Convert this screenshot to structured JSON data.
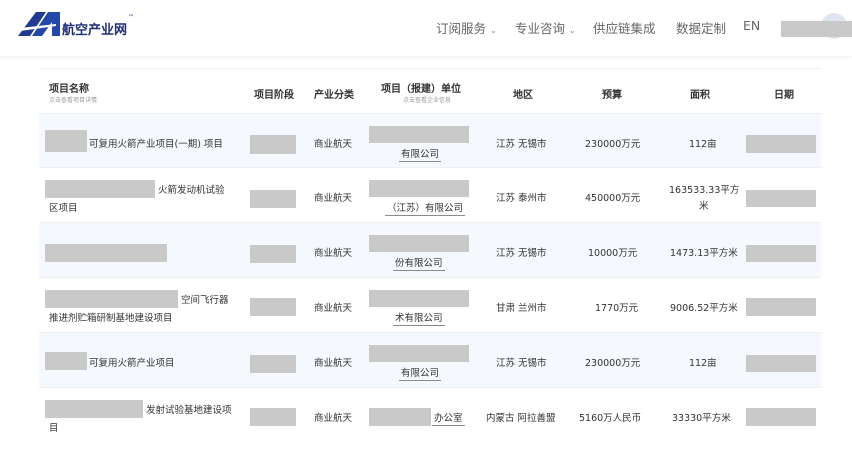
{
  "header": {
    "logo_text": "航空产业网",
    "logo_tm": "™",
    "nav": [
      {
        "label": "订阅服务",
        "has_caret": true
      },
      {
        "label": "专业咨询",
        "has_caret": true
      },
      {
        "label": "供应链集成",
        "has_caret": false
      },
      {
        "label": "数据定制",
        "has_caret": false
      },
      {
        "label": "EN",
        "has_caret": false
      }
    ]
  },
  "table": {
    "headers": {
      "name": "项目名称",
      "name_sub": "点击查看项目详情",
      "stage": "项目阶段",
      "category": "产业分类",
      "unit": "项目（报建）单位",
      "unit_sub": "点击查看企业信息",
      "region": "地区",
      "budget": "预算",
      "area": "面积",
      "date": "日期"
    },
    "rows": [
      {
        "name": "可复用火箭产业项目(一期) 项目",
        "category": "商业航天",
        "unit": "有限公司",
        "region": "江苏 无锡市",
        "budget": "230000万元",
        "area": "112亩"
      },
      {
        "name_line1": "火箭发动机试验",
        "name_line2": "区项目",
        "category": "商业航天",
        "unit": "（江苏）有限公司",
        "region": "江苏 泰州市",
        "budget": "450000万元",
        "area_line1": "163533.33平方",
        "area_line2": "米"
      },
      {
        "name": "",
        "category": "商业航天",
        "unit": "份有限公司",
        "region": "江苏 无锡市",
        "budget": "10000万元",
        "area": "1473.13平方米"
      },
      {
        "name_line1": "空间飞行器",
        "name_line2": "推进剂贮箱研制基地建设项目",
        "category": "商业航天",
        "unit": "术有限公司",
        "region": "甘肃 兰州市",
        "budget": "1770万元",
        "area": "9006.52平方米"
      },
      {
        "name": "可复用火箭产业项目",
        "category": "商业航天",
        "unit": "有限公司",
        "region": "江苏 无锡市",
        "budget": "230000万元",
        "area": "112亩"
      },
      {
        "name_line1": "发射试验基地建设项",
        "name_line2": "目",
        "category": "商业航天",
        "unit": "办公室",
        "region": "内蒙古 阿拉善盟",
        "budget": "5160万人民币",
        "area": "33330平方米"
      }
    ]
  }
}
